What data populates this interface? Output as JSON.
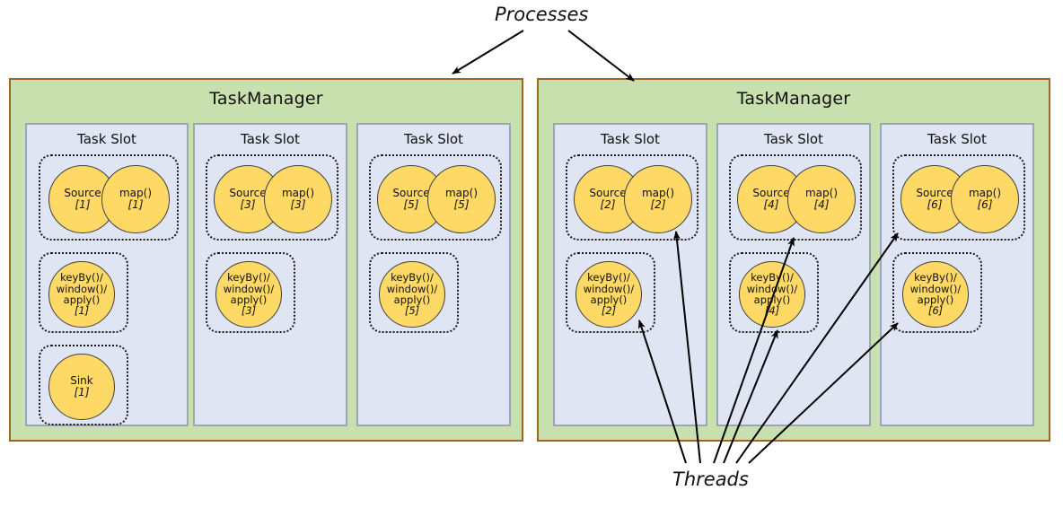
{
  "diagram": {
    "title_labels": {
      "processes": "Processes",
      "threads": "Threads"
    },
    "colors": {
      "taskmanager_fill": "#c8e0ae",
      "taskmanager_border": "#99681c",
      "taskslot_fill": "#dfe5f3",
      "taskslot_border": "#9ba5b4",
      "operator_fill": "#ffd966",
      "operator_border": "#3f3f3f",
      "group_border": "#1a1a1a",
      "arrow": "#000000",
      "background": "#ffffff"
    },
    "taskmanagers": [
      {
        "label": "TaskManager",
        "slots": [
          {
            "label": "Task Slot",
            "groups": [
              {
                "operators": [
                  {
                    "name": "Source",
                    "index": "[1]"
                  },
                  {
                    "name": "map()",
                    "index": "[1]"
                  }
                ]
              },
              {
                "operators": [
                  {
                    "name": "keyBy()/\nwindow()/\napply()",
                    "index": "[1]"
                  }
                ]
              },
              {
                "operators": [
                  {
                    "name": "Sink",
                    "index": "[1]"
                  }
                ]
              }
            ]
          },
          {
            "label": "Task Slot",
            "groups": [
              {
                "operators": [
                  {
                    "name": "Source",
                    "index": "[3]"
                  },
                  {
                    "name": "map()",
                    "index": "[3]"
                  }
                ]
              },
              {
                "operators": [
                  {
                    "name": "keyBy()/\nwindow()/\napply()",
                    "index": "[3]"
                  }
                ]
              }
            ]
          },
          {
            "label": "Task Slot",
            "groups": [
              {
                "operators": [
                  {
                    "name": "Source",
                    "index": "[5]"
                  },
                  {
                    "name": "map()",
                    "index": "[5]"
                  }
                ]
              },
              {
                "operators": [
                  {
                    "name": "keyBy()/\nwindow()/\napply()",
                    "index": "[5]"
                  }
                ]
              }
            ]
          }
        ]
      },
      {
        "label": "TaskManager",
        "slots": [
          {
            "label": "Task Slot",
            "groups": [
              {
                "operators": [
                  {
                    "name": "Source",
                    "index": "[2]"
                  },
                  {
                    "name": "map()",
                    "index": "[2]"
                  }
                ]
              },
              {
                "operators": [
                  {
                    "name": "keyBy()/\nwindow()/\napply()",
                    "index": "[2]"
                  }
                ]
              }
            ]
          },
          {
            "label": "Task Slot",
            "groups": [
              {
                "operators": [
                  {
                    "name": "Source",
                    "index": "[4]"
                  },
                  {
                    "name": "map()",
                    "index": "[4]"
                  }
                ]
              },
              {
                "operators": [
                  {
                    "name": "keyBy()/\nwindow()/\napply()",
                    "index": "[4]"
                  }
                ]
              }
            ]
          },
          {
            "label": "Task Slot",
            "groups": [
              {
                "operators": [
                  {
                    "name": "Source",
                    "index": "[6]"
                  },
                  {
                    "name": "map()",
                    "index": "[6]"
                  }
                ]
              },
              {
                "operators": [
                  {
                    "name": "keyBy()/\nwindow()/\napply()",
                    "index": "[6]"
                  }
                ]
              }
            ]
          }
        ]
      }
    ],
    "annotations": {
      "processes_arrow_count": 2,
      "threads_arrow_count": 6
    }
  }
}
